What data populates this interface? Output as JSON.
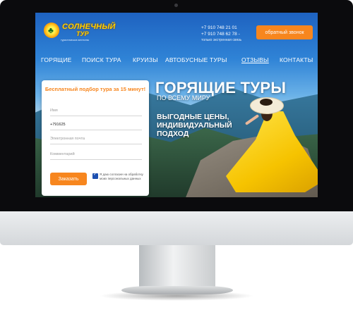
{
  "header": {
    "logo": {
      "name_line1": "СОЛНЕЧНЫЙ",
      "name_line2": "ТУР",
      "tagline": "туристическое агентство"
    },
    "phones": {
      "phone1": "+7 910 748 21 01",
      "phone2": "+7 910 748 62 78 -",
      "note": "только экстренная связь"
    },
    "callback_label": "обратный звонок"
  },
  "nav": {
    "items": [
      "ГОРЯЩИЕ",
      "ПОИСК ТУРА",
      "КРУИЗЫ",
      "АВТОБУСНЫЕ ТУРЫ",
      "ОТЗЫВЫ",
      "КОНТАКТЫ"
    ],
    "active": "ОТЗЫВЫ"
  },
  "hero": {
    "headline": "ГОРЯЩИЕ ТУРЫ",
    "subheadline": "ПО ВСЕМУ МИРУ",
    "benefits": "ВЫГОДНЫЕ ЦЕНЫ, ИНДИВИДУАЛЬНЫЙ ПОДХОД"
  },
  "form": {
    "title": "Бесплатный подбор тура за 15 минут!",
    "name_placeholder": "Имя",
    "phone_value": "+791625",
    "email_placeholder": "Электронная почта",
    "comment_placeholder": "Комментарий",
    "submit_label": "Заказать",
    "consent": "Я даю согласие на обработку моих персональных данных",
    "consent_checked": true
  },
  "colors": {
    "accent": "#f7861e",
    "checkbox": "#1c4fb0"
  }
}
